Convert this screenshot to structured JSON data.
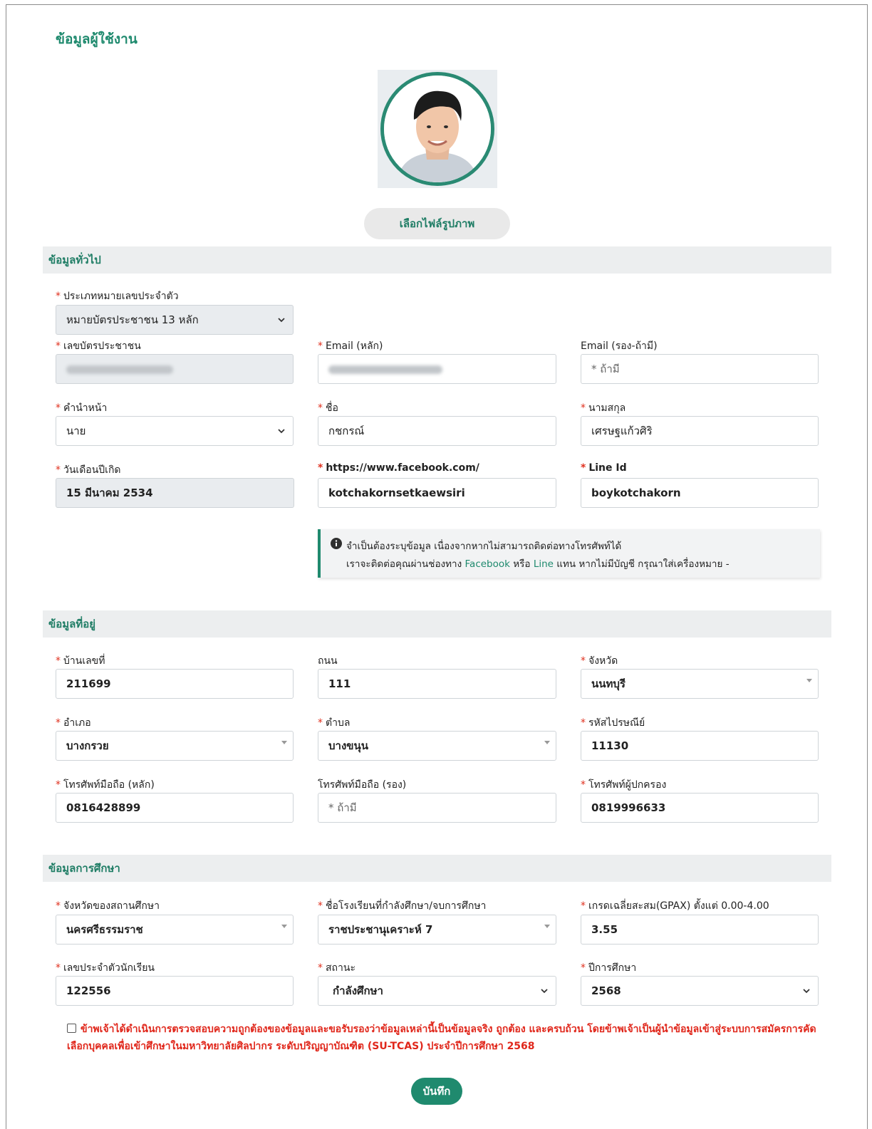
{
  "page": {
    "title": "ข้อมูลผู้ใช้งาน"
  },
  "photo": {
    "button_label": "เลือกไฟล์รูปภาพ"
  },
  "general": {
    "section_title": "ข้อมูลทั่วไป",
    "id_type": {
      "label": "ประเภทหมายเลขประจำตัว",
      "value": "หมายบัตรประชาชน 13 หลัก"
    },
    "citizen_id": {
      "label": "เลขบัตรประชาชน"
    },
    "email_main": {
      "label": "Email (หลัก)"
    },
    "email_alt": {
      "label": "Email (รอง-ถ้ามี)",
      "placeholder": "* ถ้ามี"
    },
    "prefix": {
      "label": "คำนำหน้า",
      "value": "นาย"
    },
    "first_name": {
      "label": "ชื่อ",
      "value": "กชกรณ์"
    },
    "last_name": {
      "label": "นามสกุล",
      "value": "เศรษฐแก้วศิริ"
    },
    "birth_date": {
      "label": "วันเดือนปีเกิด",
      "value": "15 มีนาคม 2534"
    },
    "facebook": {
      "label": "https://www.facebook.com/",
      "value": "kotchakornsetkaewsiri"
    },
    "line_id": {
      "label": "Line Id",
      "value": "boykotchakorn"
    },
    "notice": {
      "line1": "จำเป็นต้องระบุข้อมูล เนื่องจากหากไม่สามารถติดต่อทางโทรศัพท์ได้",
      "line2_prefix": "เราจะติดต่อคุณผ่านช่องทาง",
      "facebook_word": "Facebook",
      "or_word": "หรือ",
      "line_word": "Line",
      "line2_suffix": "แทน หากไม่มีบัญชี กรุณาใส่เครื่องหมาย -"
    }
  },
  "address": {
    "section_title": "ข้อมูลที่อยู่",
    "house_no": {
      "label": "บ้านเลขที่",
      "value": "211699"
    },
    "road": {
      "label": "ถนน",
      "value": "111"
    },
    "province": {
      "label": "จังหวัด",
      "value": "นนทบุรี"
    },
    "district": {
      "label": "อำเภอ",
      "value": "บางกรวย"
    },
    "subdistrict": {
      "label": "ตำบล",
      "value": "บางขนุน"
    },
    "postcode": {
      "label": "รหัสไปรษณีย์",
      "value": "11130"
    },
    "mobile_main": {
      "label": "โทรศัพท์มือถือ (หลัก)",
      "value": "0816428899"
    },
    "mobile_alt": {
      "label": "โทรศัพท์มือถือ (รอง)",
      "placeholder": "* ถ้ามี"
    },
    "guardian_phone": {
      "label": "โทรศัพท์ผู้ปกครอง",
      "value": "0819996633"
    }
  },
  "education": {
    "section_title": "ข้อมูลการศึกษา",
    "school_province": {
      "label": "จังหวัดของสถานศึกษา",
      "value": "นครศรีธรรมราช"
    },
    "school_name": {
      "label": "ชื่อโรงเรียนที่กำลังศึกษา/จบการศึกษา",
      "value": "ราชประชานุเคราะห์ 7"
    },
    "gpax": {
      "label": "เกรดเฉลี่ยสะสม(GPAX) ตั้งแต่ 0.00-4.00",
      "value": "3.55"
    },
    "student_id": {
      "label": "เลขประจำตัวนักเรียน",
      "value": "122556"
    },
    "status": {
      "label": "สถานะ",
      "value": "กำลังศึกษา"
    },
    "year": {
      "label": "ปีการศึกษา",
      "value": "2568"
    }
  },
  "consent": {
    "text": "ข้าพเจ้าได้ดำเนินการตรวจสอบความถูกต้องของข้อมูลและขอรับรองว่าข้อมูลเหล่านี้เป็นข้อมูลจริง ถูกต้อง และครบถ้วน โดยข้าพเจ้าเป็นผู้นำข้อมูลเข้าสู่ระบบการสมัครการคัดเลือกบุคคลเพื่อเข้าศึกษาในมหาวิทยาลัยศิลปากร ระดับปริญญาบัณฑิต (SU-TCAS) ประจำปีการศึกษา 2568"
  },
  "actions": {
    "save_label": "บันทึก"
  },
  "colors": {
    "brand": "#1f8a6e",
    "required": "#e0301e",
    "section_bg": "#eceeef"
  }
}
